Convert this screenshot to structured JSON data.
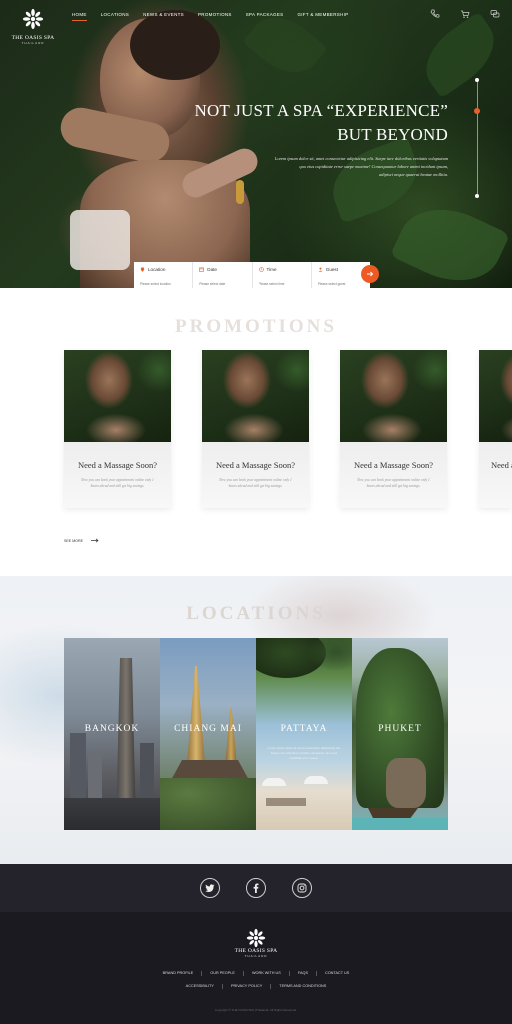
{
  "brand": {
    "name": "THE OASIS SPA",
    "sub": "THAILAND"
  },
  "nav": {
    "items": [
      {
        "label": "HOME",
        "active": true
      },
      {
        "label": "LOCATIONS"
      },
      {
        "label": "NEWS & EVENTS"
      },
      {
        "label": "PROMOTIONS"
      },
      {
        "label": "SPA PACKAGES"
      },
      {
        "label": "GIFT & MEMBERSHIP"
      }
    ],
    "icons": [
      "phone-icon",
      "cart-icon",
      "chat-icon"
    ]
  },
  "hero": {
    "title_line1": "NOT JUST A SPA “EXPERIENCE”",
    "title_line2": "BUT BEYOND",
    "desc_line1": "Lorem ipsum dolor sit, amet consectetur adipisicing elit. Saepe iure doloribus veritatis voluptatum",
    "desc_line2": "quo eius cupiditate error saepe maxime! Consequuntur labore animi incidunt ipsum,",
    "desc_line3": "adipisci neque quaerat beatae mollitia."
  },
  "search": {
    "fields": [
      {
        "label": "Location",
        "icon": "location-pin-icon",
        "placeholder": "Please select location"
      },
      {
        "label": "Date",
        "icon": "calendar-icon",
        "placeholder": "Please select date"
      },
      {
        "label": "Time",
        "icon": "clock-icon",
        "placeholder": "Please select time"
      },
      {
        "label": "Guest",
        "icon": "user-icon",
        "placeholder": "Please select guest"
      }
    ],
    "button_icon": "arrow-right-icon",
    "accent": "#ee5a24"
  },
  "promotions": {
    "title": "PROMOTIONS",
    "cards": [
      {
        "title": "Need a Massage Soon?",
        "desc": "Now you can book your appointment online only 1 hours ahead and still get big savings."
      },
      {
        "title": "Need a Massage Soon?",
        "desc": "Now you can book your appointment online only 1 hours ahead and still get big savings."
      },
      {
        "title": "Need a Massage Soon?",
        "desc": "Now you can book your appointment online only 1 hours ahead and still get big savings."
      },
      {
        "title": "Need a Massage Soon?",
        "desc": ""
      }
    ],
    "see_more": "SEE MORE"
  },
  "locations": {
    "title": "LOCATIONS",
    "cards": [
      {
        "name": "BANGKOK",
        "desc": ""
      },
      {
        "name": "CHIANG MAI",
        "desc": ""
      },
      {
        "name": "PATTAYA",
        "desc": "Lorem ipsum dolor sit amet consectetur adipisicing elit. Saepe iure doloribus veritatis voluptatum quo eius cupiditate error saepe."
      },
      {
        "name": "PHUKET",
        "desc": ""
      }
    ]
  },
  "social": [
    "twitter-icon",
    "facebook-icon",
    "instagram-icon"
  ],
  "footer": {
    "links_row1": [
      "BRAND PROFILE",
      "OUR PEOPLE",
      "WORK WITH US",
      "FAQS",
      "CONTACT US"
    ],
    "links_row2": [
      "ACCESSIBILITY",
      "PRIVACY POLICY",
      "TERMS AND CONDITIONS"
    ],
    "copyright": "Copyright © THE OASIS SPA (Thailand). All Rights Reserved."
  },
  "colors": {
    "accent": "#e8612c",
    "footer_dark": "#1b1a21",
    "social_bar": "#24232b"
  }
}
